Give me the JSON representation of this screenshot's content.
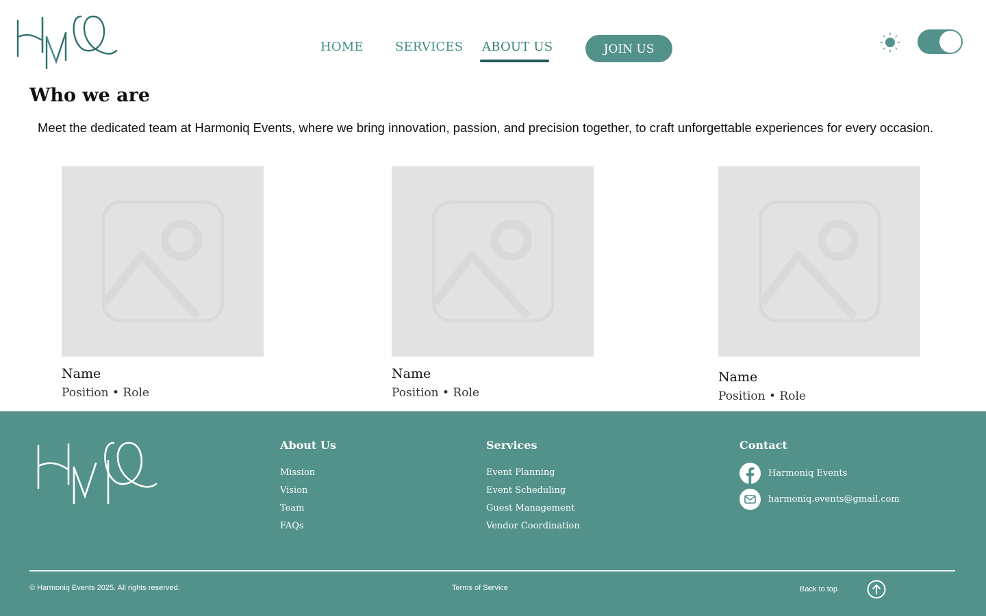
{
  "header": {
    "logo_text": "HMQ",
    "nav": {
      "home": "HOME",
      "services": "SERVICES",
      "about": "ABOUT US"
    },
    "join_label": "JOIN US",
    "theme_icon": "sun-icon",
    "theme_toggle_on": true
  },
  "main": {
    "title": "Who we are",
    "intro": "Meet the dedicated team at Harmoniq Events, where we bring innovation, passion, and precision together, to craft unforgettable experiences for every occasion.",
    "team": [
      {
        "name": "Name",
        "role": "Position • Role",
        "photo_icon": "image-placeholder-icon"
      },
      {
        "name": "Name",
        "role": "Position • Role",
        "photo_icon": "image-placeholder-icon"
      },
      {
        "name": "Name",
        "role": "Position • Role",
        "photo_icon": "image-placeholder-icon"
      }
    ]
  },
  "footer": {
    "logo_text": "HMQ",
    "about": {
      "heading": "About Us",
      "links": [
        "Mission",
        "Vision",
        "Team",
        "FAQs"
      ]
    },
    "services": {
      "heading": "Services",
      "links": [
        "Event Planning",
        "Event Scheduling",
        "Guest Management",
        "Vendor Coordination"
      ]
    },
    "contact": {
      "heading": "Contact",
      "facebook": "Harmoniq Events",
      "email": "harmoniq.events@gmail.com"
    },
    "copyright": "© Harmoniq Events 2025. All rights reserved.",
    "terms": "Terms of Service",
    "back_to_top": "Back to top"
  },
  "colors": {
    "brand_teal": "#52928a",
    "dark_teal": "#24575a",
    "placeholder_gray": "#e2e2e2"
  }
}
